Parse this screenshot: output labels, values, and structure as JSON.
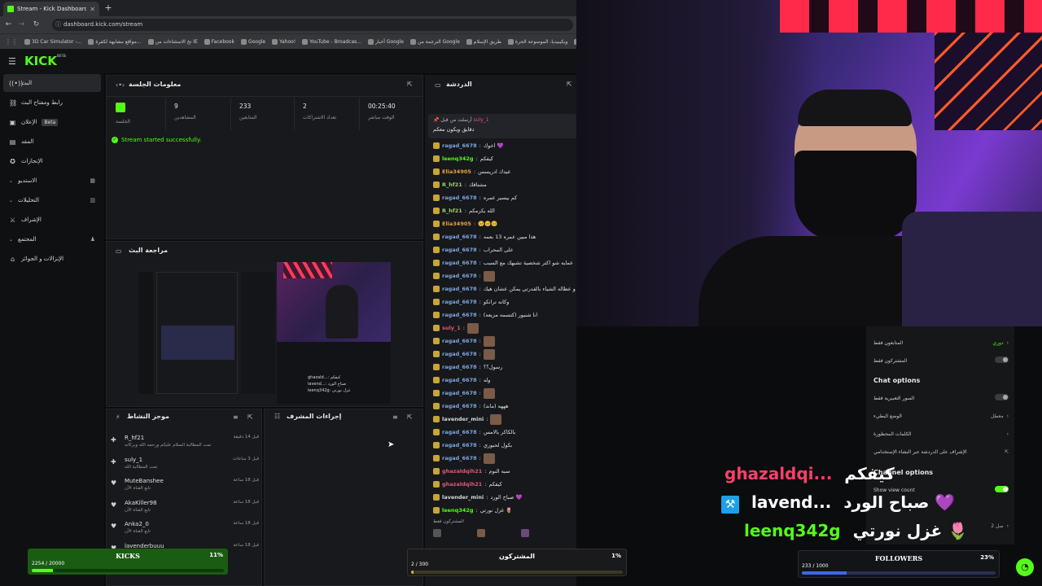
{
  "browser": {
    "tab_title": "Stream - Kick Dashboard",
    "new_tab": "+",
    "url": "dashboard.kick.com/stream",
    "bookmarks": [
      "3D Car Simulator -...",
      "مواقع مشابهة لكفرة...",
      "تخ الاستثناءات من IE",
      "Facebook",
      "Google",
      "Yahoo!",
      "YouTube - Broadcas...",
      "أخبار Google",
      "الترجمة من Google",
      "طريق الإسلام",
      "ويكيبيديا، الموسوعة الحرة",
      "ويكي"
    ]
  },
  "app": {
    "logo": "KICK",
    "logo_sup": "BETA"
  },
  "sidebar": {
    "items": [
      {
        "label": "البث",
        "icon": "broadcast-icon",
        "active": true
      },
      {
        "label": "رابط ومفتاح البث",
        "icon": "link-icon"
      },
      {
        "label": "الإعلان",
        "icon": "ad-icon",
        "badge": "Beta"
      },
      {
        "label": "المقد",
        "icon": "clip-icon"
      },
      {
        "label": "الإنجازات",
        "icon": "achievements-icon"
      },
      {
        "label": "الاستديو",
        "icon": "studio-icon",
        "chevron": true
      },
      {
        "label": "التحليلات",
        "icon": "analytics-icon",
        "chevron": true
      },
      {
        "label": "الإشراف",
        "icon": "moderation-icon"
      },
      {
        "label": "المجتمع",
        "icon": "community-icon",
        "chevron": true
      },
      {
        "label": "الإنزالات و الجوائز",
        "icon": "drops-icon"
      }
    ]
  },
  "session": {
    "title": "معلومات الجلسة",
    "stats": [
      {
        "value": "",
        "label": "الجلسة"
      },
      {
        "value": "9",
        "label": "المشاهدين"
      },
      {
        "value": "233",
        "label": "المتابعين"
      },
      {
        "value": "2",
        "label": "تعداد الاشتراكات"
      },
      {
        "value": "00:25:40",
        "label": "الوقت مباشر"
      }
    ],
    "status": "Stream started successfully."
  },
  "preview": {
    "title": "مراجعة البث",
    "mini_chat": [
      "ghazald...: كيفكم",
      "lavend...: صباح الورد",
      "leenq342g: غزل نورتي"
    ]
  },
  "activity": {
    "title": "موجز النشاط",
    "rows": [
      {
        "name": "R_hf21",
        "sub": "تمت المطالبة السلام عليكم ورحمه الله وبركاته",
        "time": "قبل 14 دقيقة",
        "icon": "gift-icon"
      },
      {
        "name": "suly_1",
        "sub": "تمت المطالبة الله",
        "time": "قبل 3 ساعات",
        "icon": "gift-icon"
      },
      {
        "name": "MuteBanshee",
        "sub": "تابع القناة الآن",
        "time": "قبل 18 ساعة",
        "icon": "heart-icon"
      },
      {
        "name": "AkaKiller98",
        "sub": "تابع القناة الآن",
        "time": "قبل 18 ساعة",
        "icon": "heart-icon"
      },
      {
        "name": "Anka2_0",
        "sub": "تابع القناة الآن",
        "time": "قبل 18 ساعة",
        "icon": "heart-icon"
      },
      {
        "name": "lavenderbuuu",
        "sub": "تابع القناة الآن",
        "time": "قبل 18 ساعة",
        "icon": "heart-icon"
      }
    ]
  },
  "modactions": {
    "title": "إجراءات المشرف"
  },
  "chat": {
    "title": "الدردشة",
    "pinned_user": "suly_1",
    "pinned_by": "أرسلت من قبل",
    "pinned_text": "دقايق ويكون معكم",
    "messages": [
      {
        "user": "ragad_6678",
        "text": "اخوك 💜",
        "color": "#7ea6e0"
      },
      {
        "user": "leenq342g",
        "text": "كيفكم",
        "color": "#53fc18"
      },
      {
        "user": "Elia34905",
        "text": "عيدك ادريسس",
        "color": "#e6a23c"
      },
      {
        "user": "R_hf21",
        "text": "مشتاقك",
        "color": "#9ad06a"
      },
      {
        "user": "ragad_6678",
        "text": "كم بيسير عمره",
        "color": "#7ea6e0"
      },
      {
        "user": "R_hf21",
        "text": "الله يكرمكم",
        "color": "#9ad06a"
      },
      {
        "user": "Elia34905",
        "text": "🥺🥺🥺",
        "color": "#e6a23c"
      },
      {
        "user": "ragad_6678",
        "text": "هذا مبين عمره 13 بعمه",
        "color": "#7ea6e0"
      },
      {
        "user": "ragad_6678",
        "text": "على المحراب",
        "color": "#7ea6e0"
      },
      {
        "user": "ragad_6678",
        "text": "عمايه شو اكتر شخصية تشبهك مع السبب",
        "color": "#7ea6e0"
      },
      {
        "user": "ragad_6678",
        "text": "",
        "color": "#7ea6e0"
      },
      {
        "user": "ragad_6678",
        "text": "يات والشراء و عطاله الشياء بالقدرتي يمكن عشان هيك",
        "color": "#7ea6e0"
      },
      {
        "user": "ragad_6678",
        "text": "وكانه ترانكو",
        "color": "#7ea6e0"
      },
      {
        "user": "ragad_6678",
        "text": "انا شنيور (كتسمه مزيعه)",
        "color": "#7ea6e0"
      },
      {
        "user": "suly_1",
        "text": "",
        "color": "#e0567a"
      },
      {
        "user": "ragad_6678",
        "text": "",
        "color": "#7ea6e0"
      },
      {
        "user": "ragad_6678",
        "text": "",
        "color": "#7ea6e0"
      },
      {
        "user": "ragad_6678",
        "text": "رسول؟؟",
        "color": "#7ea6e0"
      },
      {
        "user": "ragad_6678",
        "text": "وله",
        "color": "#7ea6e0"
      },
      {
        "user": "ragad_6678",
        "text": "",
        "color": "#7ea6e0"
      },
      {
        "user": "ragad_6678",
        "text": "هههه (ماند)",
        "color": "#7ea6e0"
      },
      {
        "user": "lavender_mini",
        "text": "",
        "color": "#d8d8d8"
      },
      {
        "user": "ragad_6678",
        "text": "بالكاكر بالامس",
        "color": "#7ea6e0"
      },
      {
        "user": "ragad_6678",
        "text": "بكول لحبوري",
        "color": "#7ea6e0"
      },
      {
        "user": "ragad_6678",
        "text": "",
        "color": "#7ea6e0"
      },
      {
        "user": "ghazaldqih21",
        "text": "سبه النوم",
        "color": "#e0567a"
      },
      {
        "user": "ghazaldqih21",
        "text": "كيفكم",
        "color": "#e0567a"
      },
      {
        "user": "lavender_mini",
        "text": "صباح الورد 💜",
        "color": "#d8d8d8"
      },
      {
        "user": "leenq342g",
        "text": "غزل نورتي 🌷",
        "color": "#53fc18"
      }
    ],
    "subs_only": "المشتركون فقط"
  },
  "chat_settings": {
    "followers_only": "المتابعون فقط",
    "followers_value": "دوري",
    "subscribers_only": "المشتركون فقط",
    "chat_options_title": "Chat options",
    "emotes_only": "السور التعبيرية فقط",
    "slow_mode": "الوضع البطيء",
    "slow_value": "معطل",
    "blocked_words": "الكلمات المحظورة",
    "popout": "الإشراف على الدردشة عبر النشاء الإستخدامي",
    "channel_options": "Channel options",
    "show_view_count": "Show view count",
    "bottom_item": "صل 2"
  },
  "overlay": {
    "messages": [
      {
        "user": "ghazaldqi...",
        "text": "كيفكم",
        "color": "#ff3f6a"
      },
      {
        "user": "lavend...",
        "text": "صباح الورد 💜",
        "color": "#ffffff"
      },
      {
        "user": "leenq342g",
        "text": "غزل نورتي 🌷",
        "color": "#53fc18"
      }
    ]
  },
  "goals": {
    "kicks": {
      "title": "KICKS",
      "count": "2254 / 20000",
      "percent": "11%",
      "fraction": 0.11
    },
    "subs": {
      "title": "المشتركون",
      "count": "2 / 300",
      "percent": "1%",
      "fraction": 0.01
    },
    "followers": {
      "title": "FOLLOWERS",
      "count": "233 / 1000",
      "percent": "23%",
      "fraction": 0.23
    }
  },
  "colors": {
    "accent": "#53fc18"
  }
}
